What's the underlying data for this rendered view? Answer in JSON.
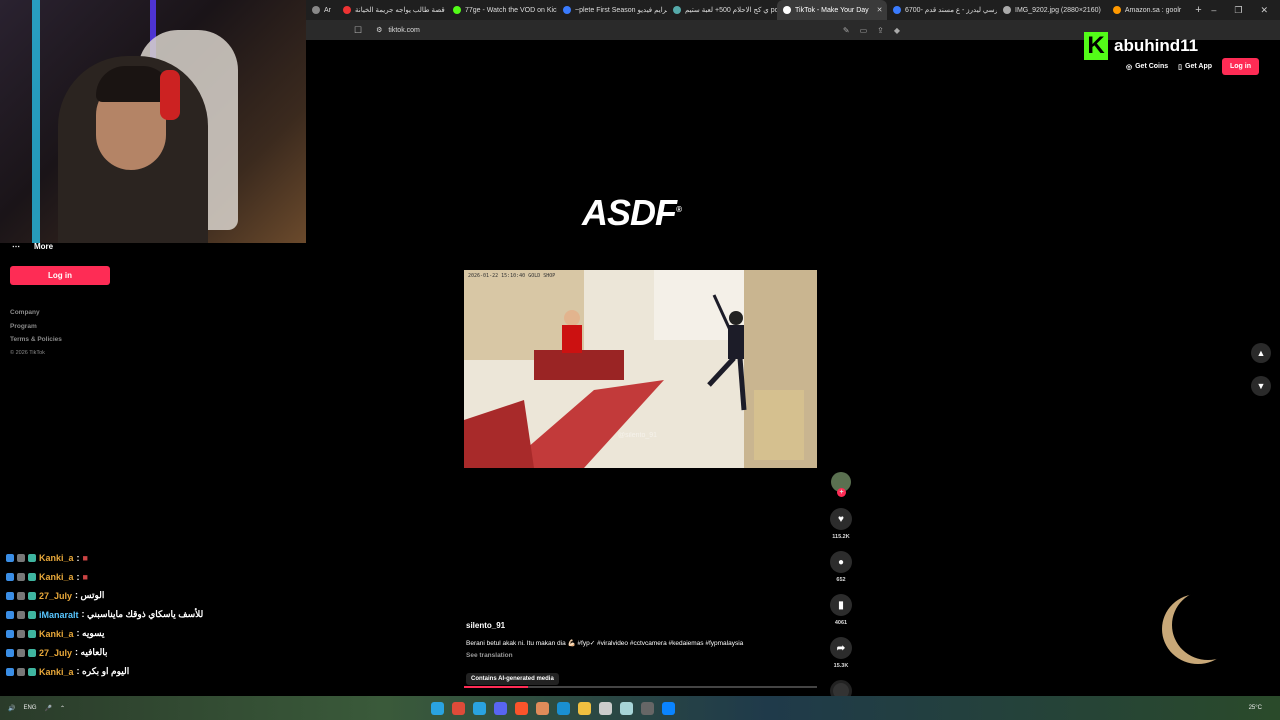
{
  "browser": {
    "tabs": [
      {
        "label": "Ar",
        "color": "#888"
      },
      {
        "label": "قصة طالب يواجه جريمة الخيانة",
        "color": "#e33"
      },
      {
        "label": "77ge - Watch the VOD on Kick",
        "color": "#53fc18"
      },
      {
        "label": "~plete First Season برايم فيديو",
        "color": "#3a7bfd"
      },
      {
        "label": "ي كج الاحلام 500+ لعبة ستيم pc",
        "color": "#5aa"
      },
      {
        "label": "TikTok - Make Your Day",
        "color": "#fff",
        "active": true
      },
      {
        "label": "6700- كرسي ليدرز - ع مسند قدم",
        "color": "#3a7bfd"
      },
      {
        "label": "IMG_9202.jpg (2880×2160)",
        "color": "#aaa"
      },
      {
        "label": "Amazon.sa : goolr",
        "color": "#f90"
      }
    ],
    "url": "tiktok.com",
    "new_tab": "+"
  },
  "sidebar": {
    "more_label": "More",
    "login_label": "Log in",
    "footer": [
      "Company",
      "Program",
      "Terms & Policies"
    ],
    "copyright": "© 2026 TikTok"
  },
  "header": {
    "streamer": "abuhind11",
    "get_coins": "Get Coins",
    "get_app": "Get App",
    "login": "Log in"
  },
  "banner": {
    "brand": "ASDF",
    "mark": "®"
  },
  "video": {
    "timestamp": "2026-01-22  15:10:40  GOLD SHOP",
    "watermark": "@silento_91",
    "progress": 0.18
  },
  "rail": {
    "likes": "115.2K",
    "comments": "652",
    "saves": "4061",
    "shares": "15.3K"
  },
  "caption": {
    "username": "silento_91",
    "text": "Berani betul akak ni. Itu makan dia 💪🏻 #fyp✓ #viralvideo #cctvcamera #kedaiemas #fypmalaysia",
    "see_translation": "See translation",
    "ai_label": "Contains AI-generated media"
  },
  "chat": [
    {
      "user": "Kanki_a",
      "msg": ":",
      "emote": true,
      "alt": false
    },
    {
      "user": "Kanki_a",
      "msg": ":",
      "emote": true,
      "alt": false
    },
    {
      "user": "27_July",
      "msg": ": الوتس",
      "alt": false
    },
    {
      "user": "iManaralt",
      "msg": ": للأسف ياسكاي ذوقك مايناسبني",
      "alt": true
    },
    {
      "user": "Kanki_a",
      "msg": ": يسويه",
      "alt": false
    },
    {
      "user": "27_July",
      "msg": ": بالعافيه",
      "alt": false
    },
    {
      "user": "Kanki_a",
      "msg": ": اليوم او بكره",
      "alt": false
    }
  ],
  "taskbar": {
    "lang": "ENG",
    "weather": "25°C"
  },
  "colors": {
    "accent": "#fe2c55",
    "kick_green": "#53fc18"
  }
}
